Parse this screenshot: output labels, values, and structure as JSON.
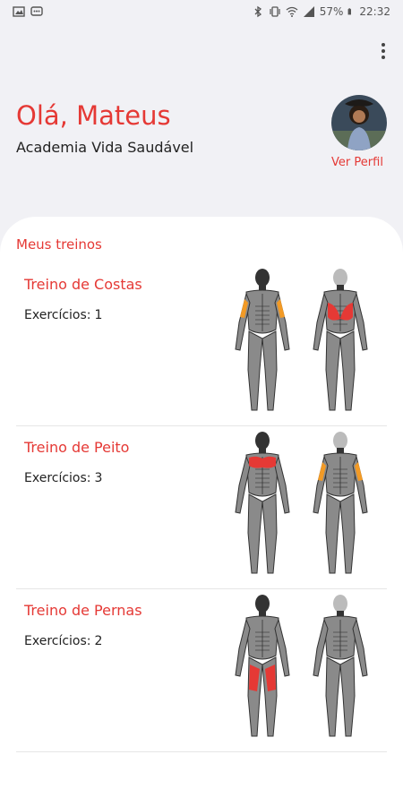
{
  "status": {
    "battery": "57%",
    "time": "22:32"
  },
  "header": {
    "greeting": "Olá, Mateus",
    "gym": "Academia Vida Saudável",
    "profile_link": "Ver Perfil"
  },
  "section_title": "Meus treinos",
  "count_label": "Exercícios:",
  "workouts": [
    {
      "name": "Treino de Costas",
      "count": "1",
      "highlight_front": "arms",
      "highlight_back": "back"
    },
    {
      "name": "Treino de Peito",
      "count": "3",
      "highlight_front": "chest",
      "highlight_back": "arms"
    },
    {
      "name": "Treino de Pernas",
      "count": "2",
      "highlight_front": "legs",
      "highlight_back": "none"
    }
  ],
  "colors": {
    "accent": "#e53935",
    "secondary_highlight": "#f29a25"
  }
}
